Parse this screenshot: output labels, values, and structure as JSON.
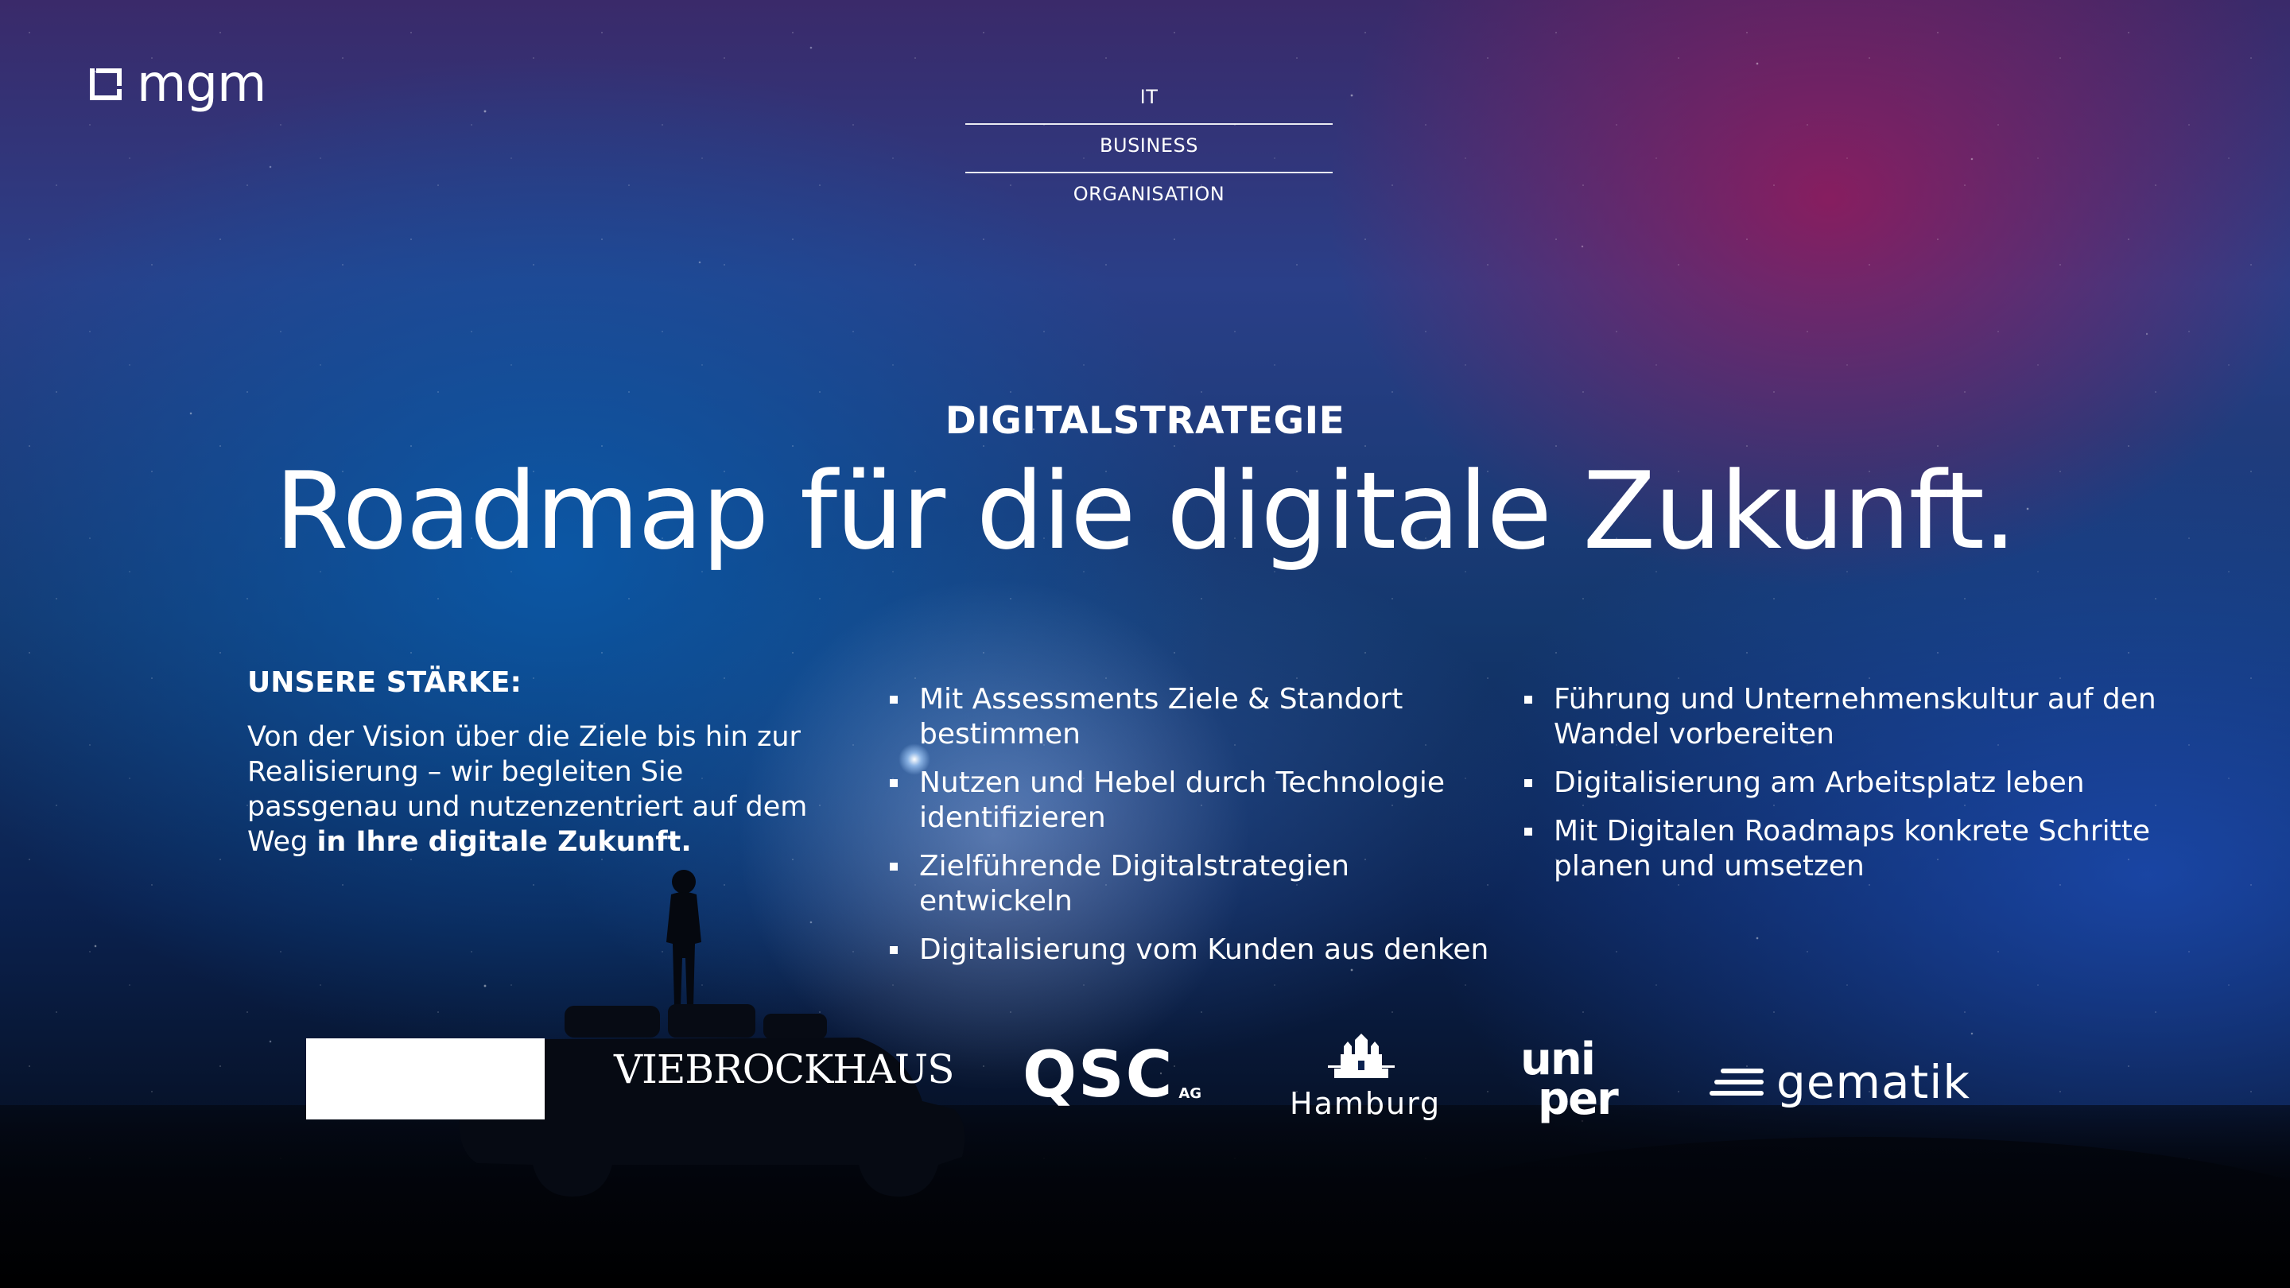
{
  "brand": {
    "name": "mgm",
    "logo_icon": "mgm-bracket-icon"
  },
  "topnav": {
    "items": [
      "IT",
      "BUSINESS",
      "ORGANISATION"
    ]
  },
  "hero": {
    "eyebrow": "DIGITALSTRATEGIE",
    "headline": "Roadmap für die digitale Zukunft."
  },
  "strength": {
    "title": "UNSERE STÄRKE:",
    "text_plain": "Von der Vision über die Ziele bis hin zur Realisierung – wir begleiten Sie passgenau und nutzenzentriert auf dem Weg ",
    "text_bold": "in Ihre digitale Zukunft."
  },
  "services_col1": [
    "Mit Assessments Ziele & Standort bestimmen",
    "Nutzen und Hebel durch Technologie identifizieren",
    "Zielführende Digitalstrategien entwickeln",
    "Digitalisierung vom Kunden aus denken"
  ],
  "services_col2": [
    "Führung und Unternehmenskultur auf den Wandel vorbereiten",
    "Digitalisierung am Arbeitsplatz leben",
    "Mit Digitalen Roadmaps konkrete Schritte planen und umsetzen"
  ],
  "clients": {
    "viebrockhaus": "VIEBROCKHAUS",
    "qsc": "QSC",
    "qsc_suffix": "AG",
    "hamburg": "Hamburg",
    "uniper_top": "uni",
    "uniper_bottom": "per",
    "gematik": "gematik"
  },
  "colors": {
    "text": "#ffffff",
    "sky_magenta": "#96195a",
    "sky_blue": "#0a5aaa",
    "ground": "#02040a"
  }
}
